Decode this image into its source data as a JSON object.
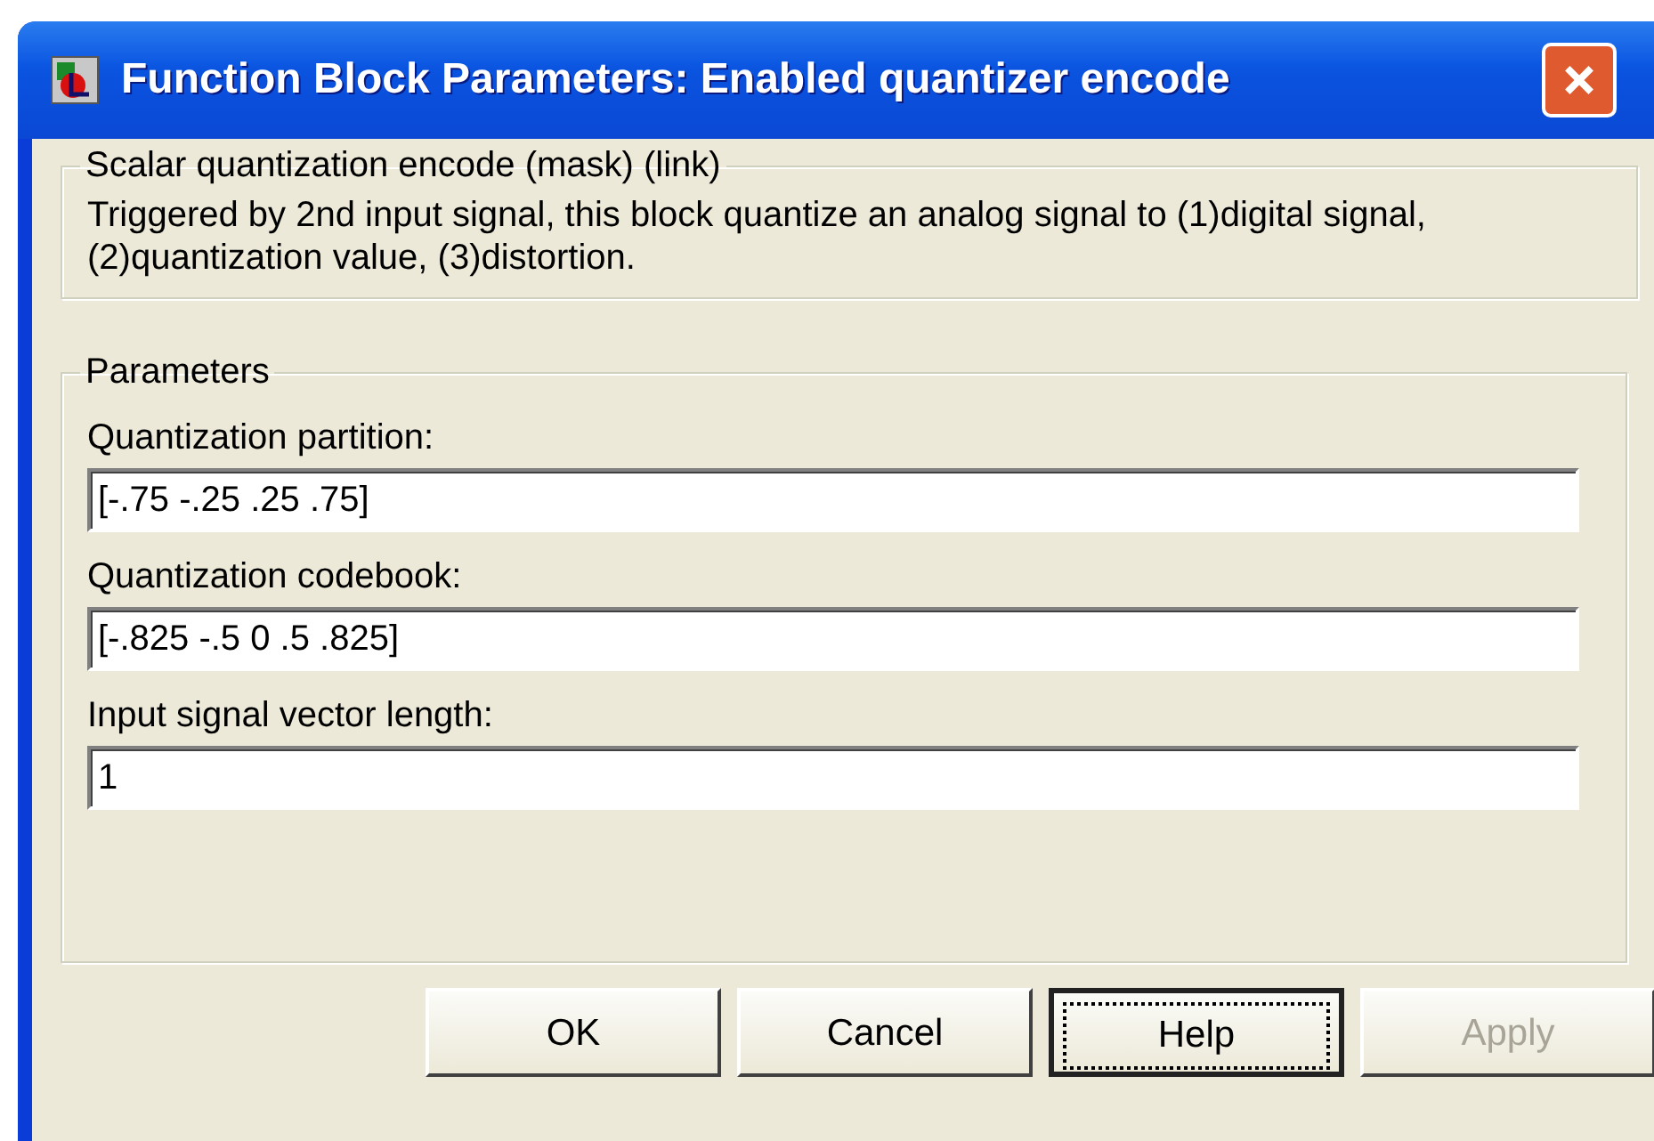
{
  "window": {
    "title": "Function Block Parameters: Enabled quantizer encode"
  },
  "description": {
    "title": "Scalar quantization encode (mask) (link)",
    "text": "Triggered by 2nd input signal, this block quantize an analog signal to (1)digital signal, (2)quantization value, (3)distortion."
  },
  "parameters": {
    "title": "Parameters",
    "fields": [
      {
        "label": "Quantization partition:",
        "value": "[-.75 -.25 .25 .75]"
      },
      {
        "label": "Quantization codebook:",
        "value": "[-.825 -.5 0 .5 .825]"
      },
      {
        "label": "Input signal vector length:",
        "value": "1"
      }
    ]
  },
  "buttons": [
    {
      "label": "OK",
      "focused": false,
      "disabled": false
    },
    {
      "label": "Cancel",
      "focused": false,
      "disabled": false
    },
    {
      "label": "Help",
      "focused": true,
      "disabled": false
    },
    {
      "label": "Apply",
      "focused": false,
      "disabled": true
    }
  ]
}
